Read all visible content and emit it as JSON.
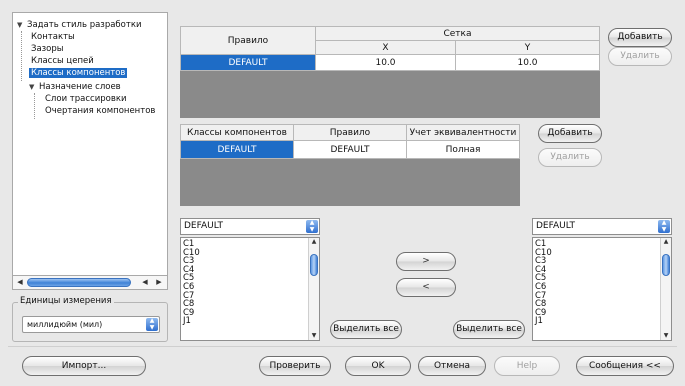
{
  "tree": {
    "items": [
      {
        "label": "Задать стиль разработки",
        "toggle": "▼"
      },
      {
        "label": "Контакты"
      },
      {
        "label": "Зазоры"
      },
      {
        "label": "Классы цепей"
      },
      {
        "label": "Классы компонентов"
      },
      {
        "label": "Назначение слоев",
        "toggle": "▼"
      },
      {
        "label": "Слои трассировки"
      },
      {
        "label": "Очертания компонентов"
      }
    ],
    "selected": "Классы компонентов"
  },
  "units": {
    "legend": "Единицы измерения",
    "value": "миллидюйм (мил)"
  },
  "grid_table": {
    "header_rule": "Правило",
    "header_group": "Сетка",
    "header_x": "X",
    "header_y": "Y",
    "row": {
      "rule": "DEFAULT",
      "x": "10.0",
      "y": "10.0"
    }
  },
  "class_table": {
    "headers": [
      "Классы компонентов",
      "Правило",
      "Учет эквивалентности"
    ],
    "row": {
      "class": "DEFAULT",
      "rule": "DEFAULT",
      "equivalence": "Полная"
    }
  },
  "buttons": {
    "add_grid": "Добавить",
    "delete_grid": "Удалить",
    "add_class": "Добавить",
    "delete_class": "Удалить",
    "move_right": ">",
    "move_left": "<",
    "select_all_left": "Выделить все",
    "select_all_right": "Выделить все",
    "import": "Импорт...",
    "check": "Проверить",
    "ok": "OK",
    "cancel": "Отмена",
    "help": "Help",
    "messages": "Сообщения <<"
  },
  "left_combo": {
    "value": "DEFAULT"
  },
  "right_combo": {
    "value": "DEFAULT"
  },
  "left_list": {
    "items": [
      "C1",
      "C10",
      "C3",
      "C4",
      "C5",
      "C6",
      "C7",
      "C8",
      "C9",
      "J1"
    ]
  },
  "right_list": {
    "items": [
      "C1",
      "C10",
      "C3",
      "C4",
      "C5",
      "C6",
      "C7",
      "C8",
      "C9",
      "J1"
    ]
  },
  "colors": {
    "selection": "#1e6cc6",
    "table_bg": "#8a8a8a"
  }
}
